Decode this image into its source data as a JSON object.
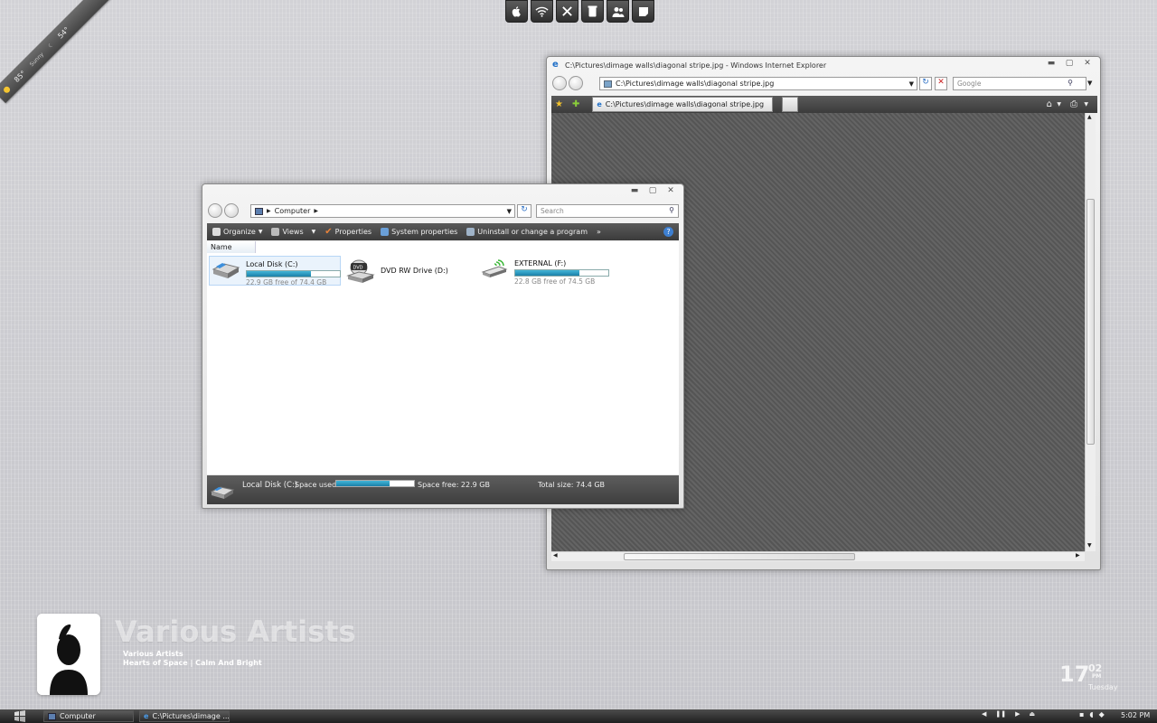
{
  "weather": {
    "temp_high": "85°",
    "condition": "Sunny",
    "temp_low": "54°"
  },
  "dock": {
    "items": [
      {
        "icon": "apple-icon",
        "glyph": ""
      },
      {
        "icon": "wifi-icon",
        "glyph": "◉"
      },
      {
        "icon": "tools-icon",
        "glyph": "✕"
      },
      {
        "icon": "trash-icon",
        "glyph": "▮"
      },
      {
        "icon": "users-icon",
        "glyph": "☻"
      },
      {
        "icon": "notes-icon",
        "glyph": "◆"
      }
    ]
  },
  "explorer": {
    "address": "Computer",
    "search_placeholder": "Search",
    "toolbar": {
      "organize": "Organize",
      "views": "Views",
      "properties": "Properties",
      "system_properties": "System properties",
      "uninstall": "Uninstall or change a program",
      "more": "»"
    },
    "column_name": "Name",
    "drives": [
      {
        "name": "Local Disk (C:)",
        "info": "22.9 GB free of 74.4 GB",
        "used_fraction": 0.69
      },
      {
        "name": "DVD RW Drive (D:)",
        "info": ""
      },
      {
        "name": "EXTERNAL (F:)",
        "info": "22.8 GB free of 74.5 GB",
        "used_fraction": 0.69
      }
    ],
    "status": {
      "drive_name": "Local Disk (C:)",
      "space_used_label": "Space used:",
      "space_free": "Space free: 22.9 GB",
      "total_size": "Total size: 74.4 GB"
    }
  },
  "ie": {
    "title": "C:\\Pictures\\dimage walls\\diagonal stripe.jpg - Windows Internet Explorer",
    "address": "C:\\Pictures\\dimage walls\\diagonal stripe.jpg",
    "search_placeholder": "Google",
    "tab_label": "C:\\Pictures\\dimage walls\\diagonal stripe.jpg"
  },
  "music": {
    "artist_big": "Various Artists",
    "artist": "Various Artists",
    "album_line": "Hearts of Space  |  Calm And Bright"
  },
  "clock": {
    "hour": "17",
    "minute": "02",
    "ampm": "PM",
    "day": "Tuesday"
  },
  "taskbar": {
    "tasks": [
      "Computer",
      "C:\\Pictures\\dimage ..."
    ],
    "time": "5:02 PM"
  },
  "colors": {
    "accent": "#1a7fa8",
    "titlebar_dark": "#3b3b3b"
  }
}
